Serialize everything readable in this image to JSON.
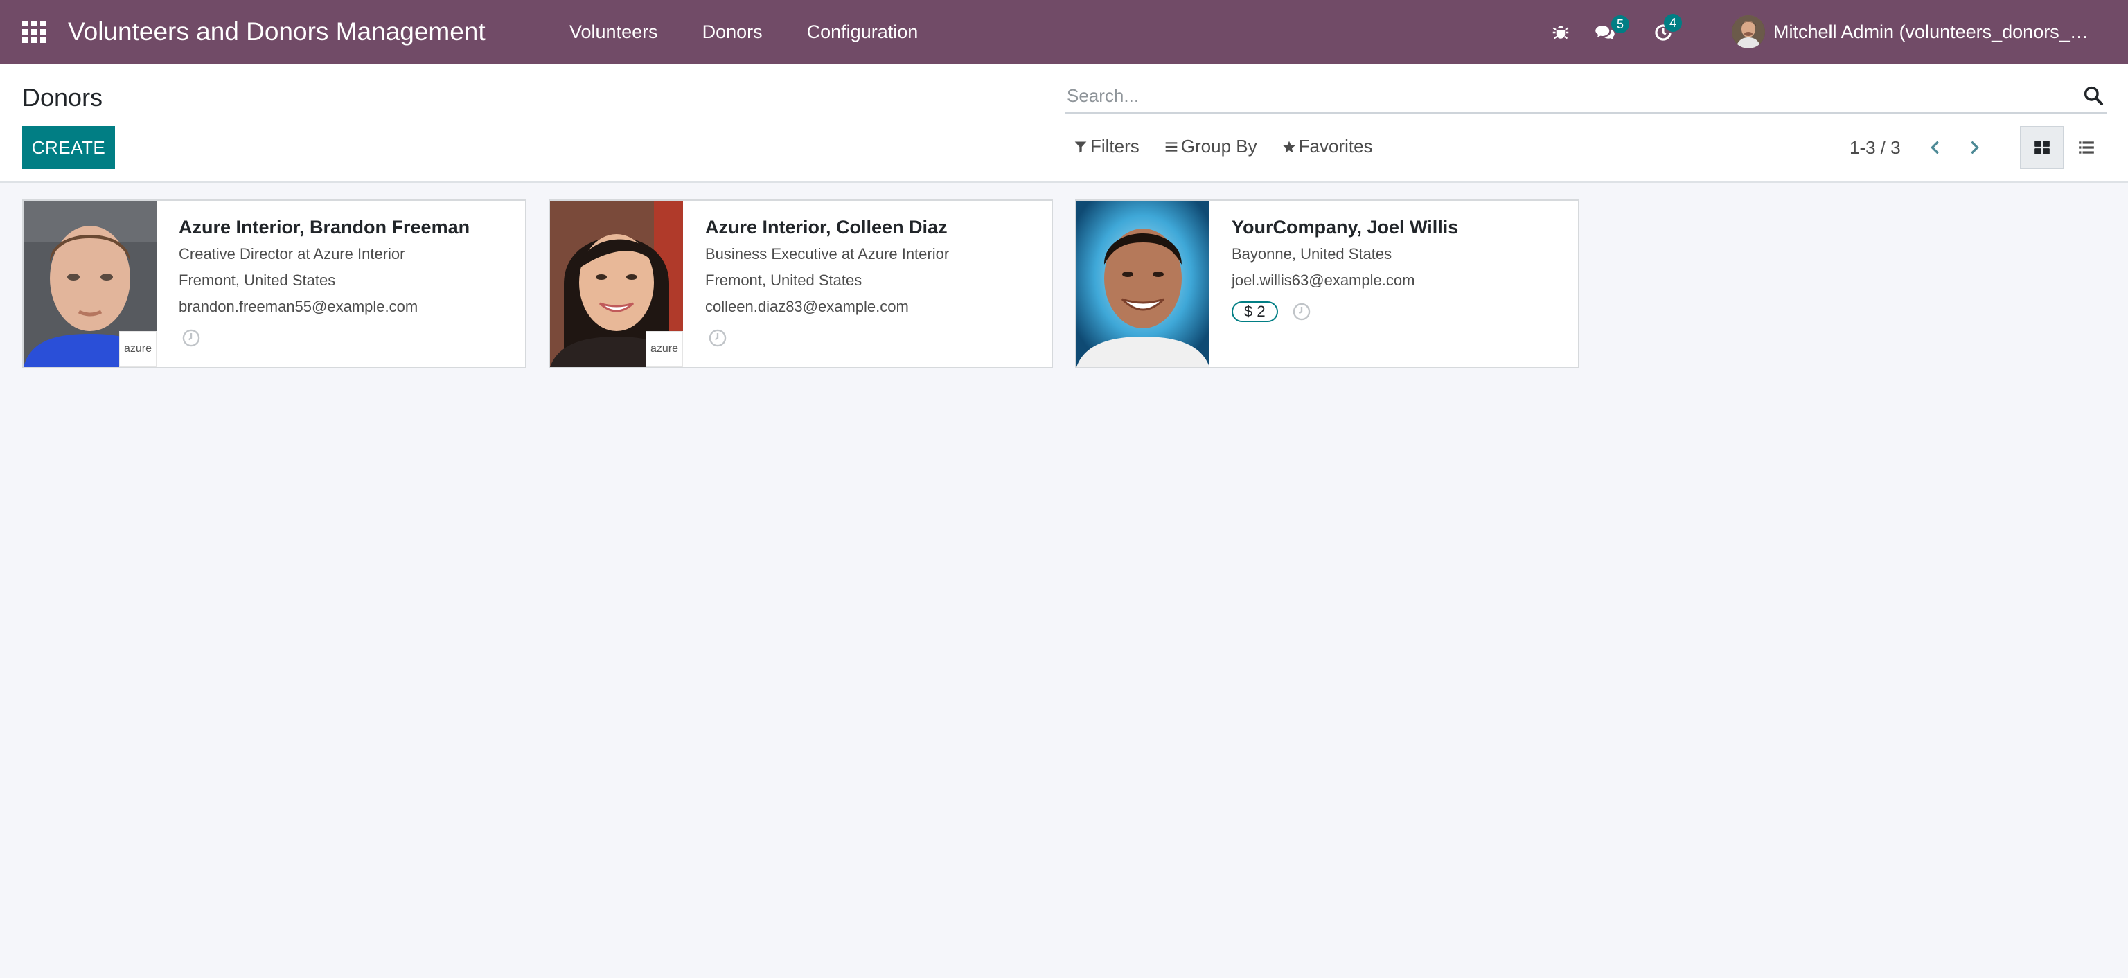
{
  "navbar": {
    "app_title": "Volunteers and Donors Management",
    "menu": [
      {
        "label": "Volunteers"
      },
      {
        "label": "Donors"
      },
      {
        "label": "Configuration"
      }
    ],
    "messages_count": "5",
    "activities_count": "4",
    "user_name": "Mitchell Admin (volunteers_donors_management)"
  },
  "control_panel": {
    "title": "Donors",
    "create_label": "CREATE",
    "search_placeholder": "Search...",
    "filters_label": "Filters",
    "group_by_label": "Group By",
    "favorites_label": "Favorites",
    "pager": "1-3 / 3"
  },
  "cards": [
    {
      "name": "Azure Interior, Brandon Freeman",
      "line1": "Creative Director at Azure Interior",
      "line2": "Fremont, United States",
      "line3": "brandon.freeman55@example.com",
      "logo": "azure"
    },
    {
      "name": "Azure Interior, Colleen Diaz",
      "line1": "Business Executive at Azure Interior",
      "line2": "Fremont, United States",
      "line3": "colleen.diaz83@example.com",
      "logo": "azure"
    },
    {
      "name": "YourCompany, Joel Willis",
      "line1": "Bayonne, United States",
      "line2": "joel.willis63@example.com",
      "tag": "$ 2"
    }
  ],
  "colors": {
    "navbar": "#714b67",
    "primary": "#017e84",
    "background": "#f5f6fa"
  },
  "icons": {
    "apps": "apps-grid-icon",
    "debug": "bug-icon",
    "messages": "chat-icon",
    "activities": "clock-icon",
    "search": "search-icon",
    "filters": "filter-icon",
    "group_by": "list-bars-icon",
    "favorites": "star-icon",
    "prev": "chevron-left-icon",
    "next": "chevron-right-icon",
    "kanban_view": "kanban-grid-icon",
    "list_view": "list-view-icon"
  }
}
